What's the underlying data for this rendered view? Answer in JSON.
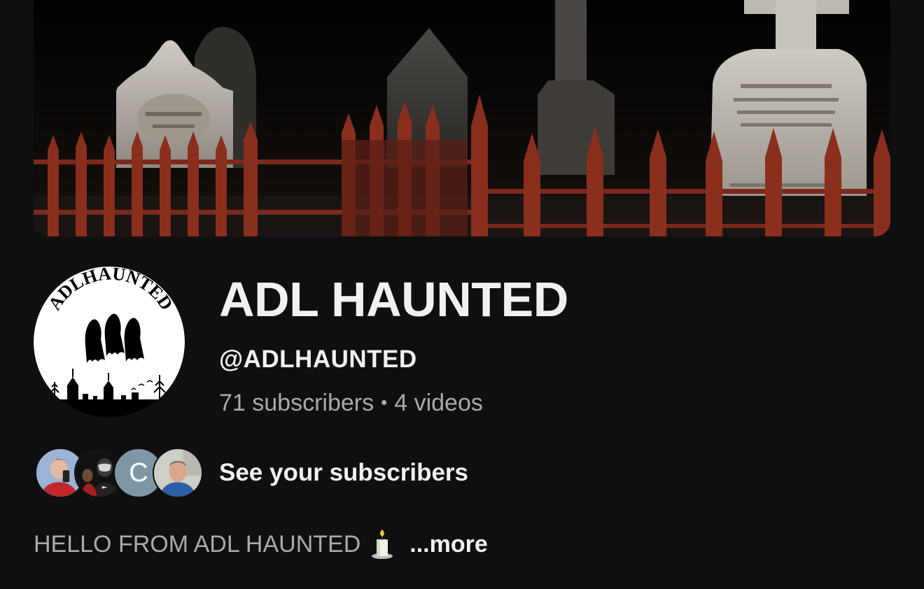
{
  "channel": {
    "name": "ADL HAUNTED",
    "handle": "@ADLHAUNTED",
    "subscribers": "71 subscribers",
    "separator": "•",
    "videos": "4 videos",
    "logo_text": "ADLHAUNTED"
  },
  "subscribers_row": {
    "label": "See your subscribers",
    "avatars": [
      {
        "kind": "photo"
      },
      {
        "kind": "photo"
      },
      {
        "kind": "letter",
        "letter": "C",
        "color": "#7f97a5"
      },
      {
        "kind": "photo"
      }
    ]
  },
  "description": {
    "text": "HELLO FROM ADL HAUNTED",
    "emoji_icon": "candle-icon",
    "more_label": "...more"
  },
  "colors": {
    "background": "#0f0f0f",
    "primary_text": "#f1f1f1",
    "secondary_text": "#aaaaaa",
    "fence": "#7a2a1c"
  }
}
